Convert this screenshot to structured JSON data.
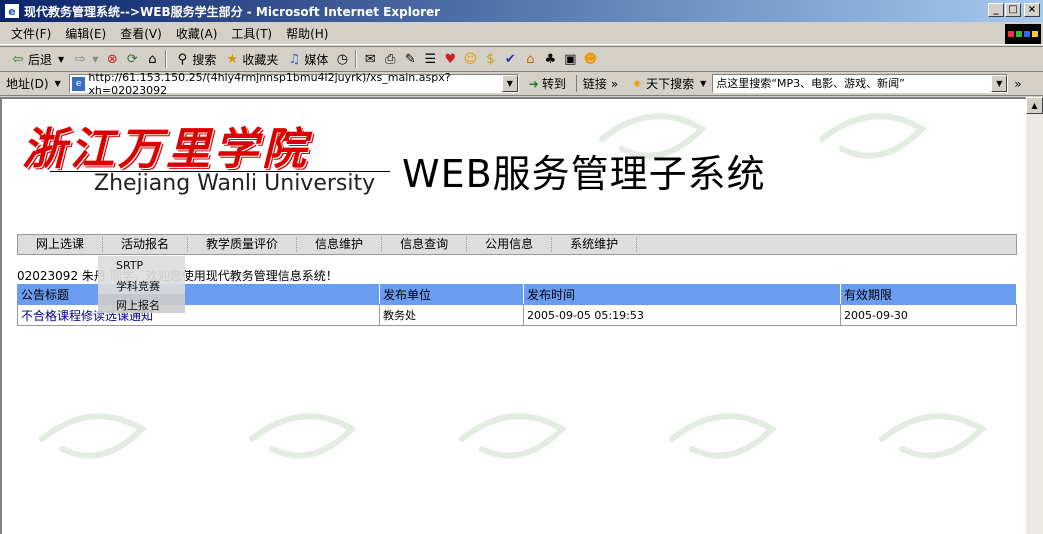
{
  "window": {
    "title": "现代教务管理系统-->WEB服务学生部分 - Microsoft Internet Explorer",
    "minimize": "_",
    "maximize": "□",
    "close": "×"
  },
  "menu": {
    "items": [
      "文件(F)",
      "编辑(E)",
      "查看(V)",
      "收藏(A)",
      "工具(T)",
      "帮助(H)"
    ]
  },
  "toolbar": {
    "back": "后退",
    "search": "搜索",
    "favorites": "收藏夹",
    "media": "媒体"
  },
  "address_bar": {
    "label": "地址(D)",
    "url": "http://61.153.150.25/(4hiy4rmjnnsp1bmu4l2juyrk)/xs_main.aspx?xh=02023092",
    "go": "转到",
    "links": "链接",
    "search_label": "天下搜索",
    "search_placeholder": "点这里搜索“MP3、电影、游戏、新闻”"
  },
  "header": {
    "logo_cn": "浙江万里学院",
    "logo_en": "Zhejiang Wanli University",
    "system_title": "WEB服务管理子系统"
  },
  "nav": {
    "items": [
      "网上选课",
      "活动报名",
      "教学质量评价",
      "信息维护",
      "信息查询",
      "公用信息",
      "系统维护"
    ],
    "dropdown": [
      "SRTP",
      "学科竞赛",
      "网上报名"
    ]
  },
  "welcome": {
    "student_id": "02023092",
    "name": "朱丹",
    "text": "同学，欢迎您使用现代教务管理信息系统！"
  },
  "notices": {
    "columns": [
      "公告标题",
      "发布单位",
      "发布时间",
      "有效期限"
    ],
    "rows": [
      {
        "title": "不合格课程修读选课通知",
        "unit": "教务处",
        "time": "2005-09-05 05:19:53",
        "expires": "2005-09-30"
      }
    ]
  }
}
